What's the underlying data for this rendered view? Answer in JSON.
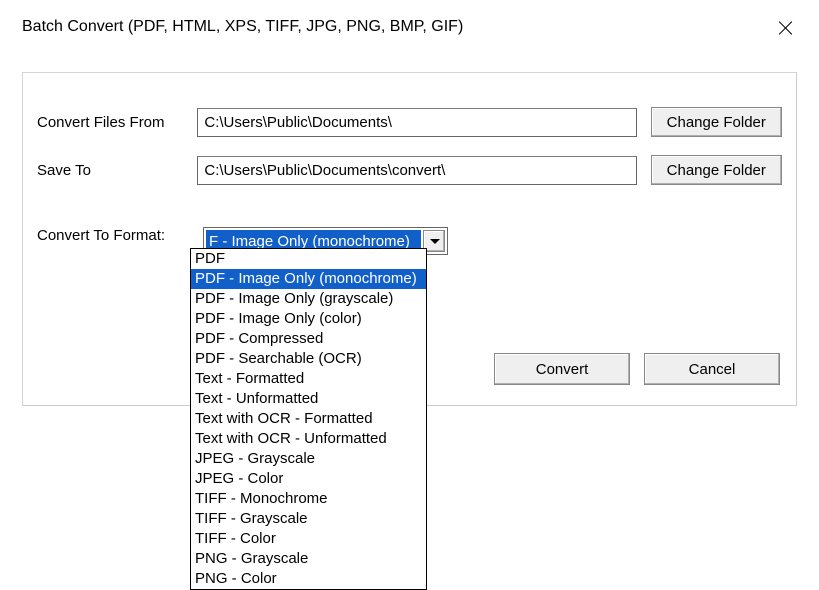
{
  "window": {
    "title": "Batch Convert (PDF, HTML, XPS, TIFF, JPG, PNG, BMP, GIF)"
  },
  "labels": {
    "from": "Convert Files From",
    "to": "Save To",
    "format": "Convert To Format:"
  },
  "paths": {
    "from": "C:\\Users\\Public\\Documents\\",
    "to": "C:\\Users\\Public\\Documents\\convert\\"
  },
  "buttons": {
    "change": "Change Folder",
    "convert": "Convert",
    "cancel": "Cancel"
  },
  "format": {
    "selected_display": "F - Image Only (monochrome)",
    "selected_index": 1,
    "options": [
      "PDF",
      "PDF - Image Only (monochrome)",
      "PDF - Image Only (grayscale)",
      "PDF - Image Only (color)",
      "PDF - Compressed",
      "PDF - Searchable (OCR)",
      "Text - Formatted",
      "Text - Unformatted",
      "Text with OCR - Formatted",
      "Text with OCR - Unformatted",
      "JPEG - Grayscale",
      "JPEG - Color",
      "TIFF - Monochrome",
      "TIFF - Grayscale",
      "TIFF - Color",
      "PNG - Grayscale",
      "PNG - Color"
    ]
  }
}
